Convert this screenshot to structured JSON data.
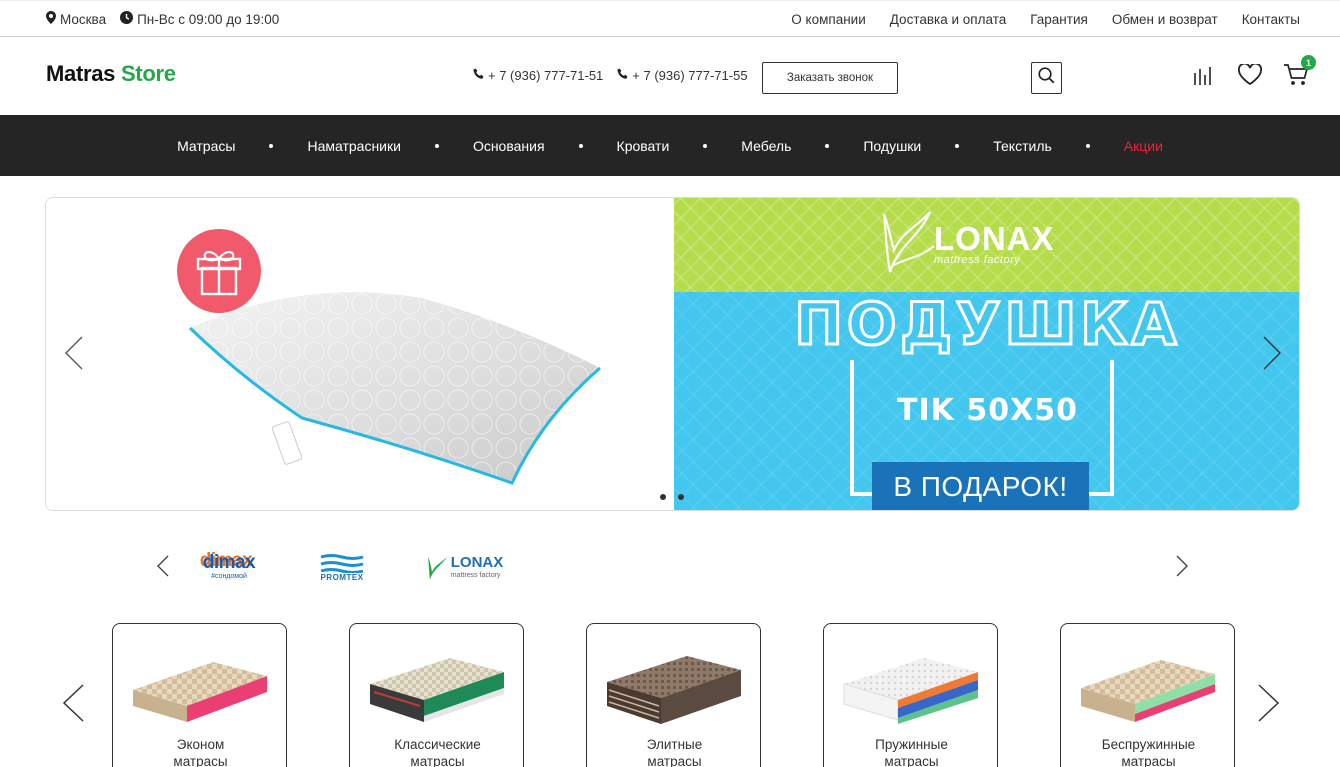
{
  "topbar": {
    "city": "Москва",
    "hours": "Пн-Вс с 09:00 до 19:00",
    "links": [
      "О компании",
      "Доставка и оплата",
      "Гарантия",
      "Обмен и возврат",
      "Контакты"
    ]
  },
  "header": {
    "logo_main": "Matras",
    "logo_accent": "Store",
    "phone1": "+ 7 (936) 777-71-51",
    "phone2": "+ 7 (936) 777-71-55",
    "callback_label": "Заказать звонок",
    "cart_count": "1"
  },
  "nav": {
    "items": [
      "Матрасы",
      "Наматрасники",
      "Основания",
      "Кровати",
      "Мебель",
      "Подушки",
      "Текстиль",
      "Акции"
    ]
  },
  "banner": {
    "brand": "LONAX",
    "brand_sub": "mattress factory",
    "title": "ПОДУШКА",
    "subtitle": "TIK 50X50",
    "gift": "В ПОДАРОК!",
    "slides": 2,
    "active_slide": 1
  },
  "brands": {
    "items": [
      {
        "name": "dimax",
        "tagline": "#сондомой"
      },
      {
        "name": "PROMTEX"
      },
      {
        "name": "LONAX",
        "tagline": "mattress factory"
      }
    ]
  },
  "categories": {
    "items": [
      {
        "line1": "Эконом",
        "line2": "матрасы"
      },
      {
        "line1": "Классические",
        "line2": "матрасы"
      },
      {
        "line1": "Элитные",
        "line2": "матрасы"
      },
      {
        "line1": "Пружинные",
        "line2": "матрасы"
      },
      {
        "line1": "Беспружинные",
        "line2": "матрасы"
      }
    ]
  },
  "colors": {
    "accent": "#22a845",
    "nav_bg": "#252525",
    "promo": "#e8253d",
    "banner_blue": "#44c7ef",
    "banner_green": "#b5dc4a"
  }
}
